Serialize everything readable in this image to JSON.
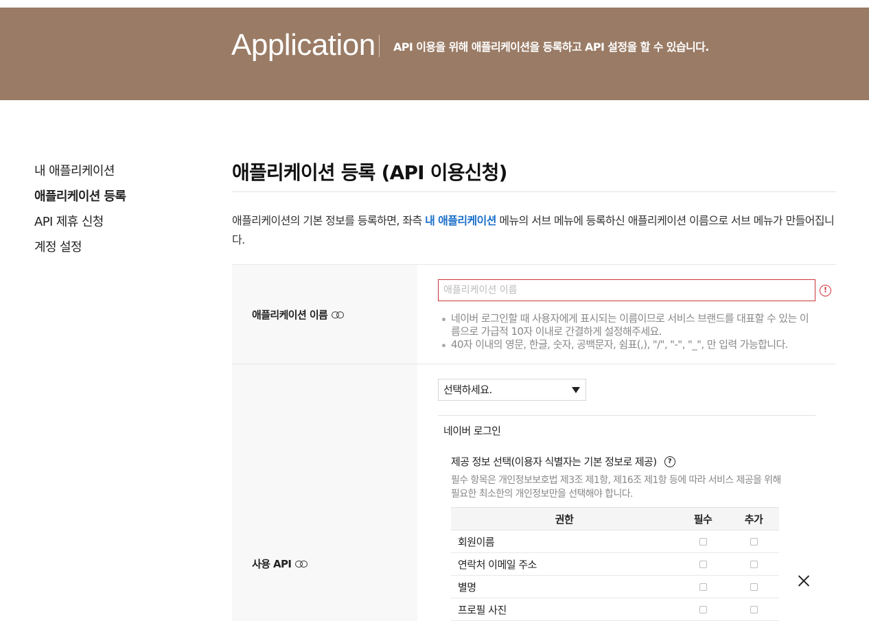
{
  "theme": {
    "hero_color": "#9a7b65",
    "error_color": "#c9343a",
    "link_color": "#1a6fc9"
  },
  "hero": {
    "title": "Application",
    "description": "API 이용을 위해 애플리케이션을 등록하고 API 설정을 할 수 있습니다."
  },
  "sidebar": {
    "items": [
      {
        "label": "내 애플리케이션",
        "active": false
      },
      {
        "label": "애플리케이션 등록",
        "active": true
      },
      {
        "label": "API 제휴 신청",
        "active": false
      },
      {
        "label": "계정 설정",
        "active": false
      }
    ]
  },
  "main": {
    "title": "애플리케이션 등록 (API 이용신청)",
    "intro_before": "애플리케이션의 기본 정보를 등록하면, 좌측 ",
    "intro_link": "내 애플리케이션",
    "intro_after": " 메뉴의 서브 메뉴에 등록하신 애플리케이션 이름으로 서브 메뉴가 만들어집니다."
  },
  "app_name": {
    "label": "애플리케이션 이름",
    "placeholder": "애플리케이션 이름",
    "value": "",
    "warning_icon": "exclamation-circle-icon",
    "hints": [
      "네이버 로그인할 때 사용자에게 표시되는 이름이므로 서비스 브랜드를 대표할 수 있는 이름으로 가급적 10자 이내로 간결하게 설정해주세요.",
      "40자 이내의 영문, 한글, 숫자, 공백문자, 쉼표(,), \"/\", \"-\", \"_\", 만 입력 가능합니다."
    ]
  },
  "api": {
    "label": "사용 API",
    "select_value": "선택하세요.",
    "panel": {
      "name": "네이버 로그인",
      "info_title": "제공 정보 선택(이용자 식별자는 기본 정보로 제공)",
      "info_note": "필수 항목은 개인정보보호법 제3조 제1항, 제16조 제1항 등에 따라 서비스 제공을 위해 필요한 최소한의 개인정보만을 선택해야 합니다.",
      "table": {
        "headers": [
          "권한",
          "필수",
          "추가"
        ],
        "rows": [
          {
            "name": "회원이름",
            "required": false,
            "optional": false
          },
          {
            "name": "연락처 이메일 주소",
            "required": false,
            "optional": false
          },
          {
            "name": "별명",
            "required": false,
            "optional": false
          },
          {
            "name": "프로필 사진",
            "required": false,
            "optional": false
          }
        ]
      }
    }
  }
}
